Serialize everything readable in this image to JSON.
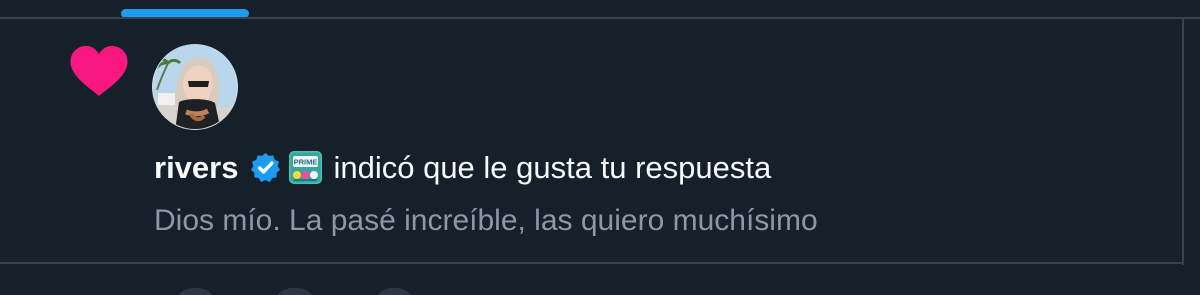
{
  "tabs": {
    "active_indicator_color": "#1d9bf0"
  },
  "notification": {
    "type": "like",
    "icon": "heart-icon",
    "icon_color": "#f91880",
    "user": {
      "display_name": "rivers",
      "verified_icon": "verified-check-icon",
      "verified_color": "#1d9bf0",
      "badge_icon": "prime-badge-icon",
      "badge_text": "PRIME"
    },
    "action_text": "indicó que le gusta tu respuesta",
    "reply_text": "Dios mío. La pasé increíble, las quiero muchísimo"
  },
  "theme": {
    "background": "#15202b",
    "divider": "#38444d",
    "primary_text": "#f7f9f9",
    "secondary_text": "#8b98a5"
  }
}
